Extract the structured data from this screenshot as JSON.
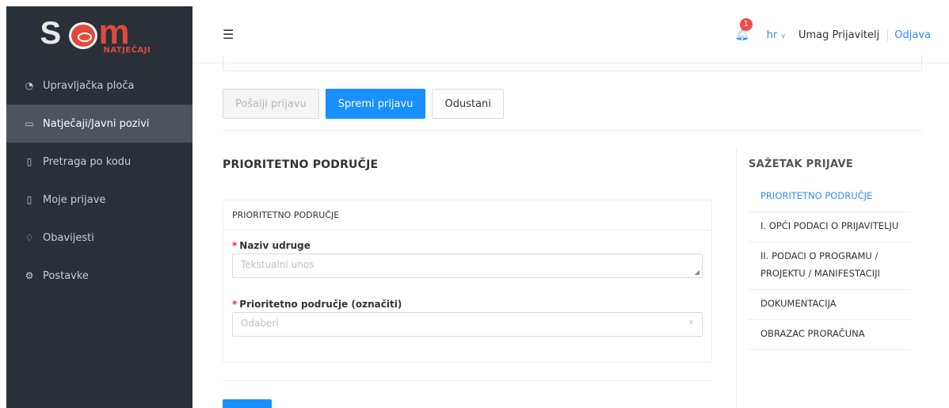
{
  "app": {
    "logo_text_sub": "NATJEČAJI"
  },
  "sidebar": {
    "items": [
      {
        "label": "Upravljačka ploča",
        "icon": "dashboard-icon",
        "active": false
      },
      {
        "label": "Natječaji/Javni pozivi",
        "icon": "folder-icon",
        "active": true
      },
      {
        "label": "Pretraga po kodu",
        "icon": "document-icon",
        "active": false
      },
      {
        "label": "Moje prijave",
        "icon": "file-icon",
        "active": false
      },
      {
        "label": "Obavijesti",
        "icon": "bell-icon",
        "active": false
      },
      {
        "label": "Postavke",
        "icon": "gear-icon",
        "active": false
      }
    ]
  },
  "header": {
    "notification_count": "1",
    "language": "hr",
    "user": "Umag Prijavitelj",
    "logout": "Odjava"
  },
  "actions": {
    "submit": "Pošalji prijavu",
    "save": "Spremi prijavu",
    "cancel": "Odustani"
  },
  "main": {
    "section_title": "PRIORITETNO PODRUČJE",
    "card_title": "PRIORITETNO PODRUČJE",
    "fields": {
      "association_name_label": "Naziv udruge",
      "association_name_placeholder": "Tekstualni unos",
      "priority_area_label": "Prioritetno područje (označiti)",
      "priority_area_placeholder": "Odaberi"
    }
  },
  "summary": {
    "title": "SAŽETAK PRIJAVE",
    "items": [
      {
        "label": "PRIORITETNO PODRUČJE",
        "active": true
      },
      {
        "label": "I. OPĆI PODACI O PRIJAVITELJU",
        "active": false
      },
      {
        "label": "II. PODACI O PROGRAMU / PROJEKTU / MANIFESTACIJI",
        "active": false
      },
      {
        "label": "DOKUMENTACIJA",
        "active": false
      },
      {
        "label": "OBRAZAC PRORAČUNA",
        "active": false
      }
    ]
  },
  "colors": {
    "primary": "#1890ff",
    "sidebar_bg": "#2a3038",
    "sidebar_active": "#4d545d",
    "brand_red": "#e04a3a",
    "badge": "#f14b4b"
  }
}
